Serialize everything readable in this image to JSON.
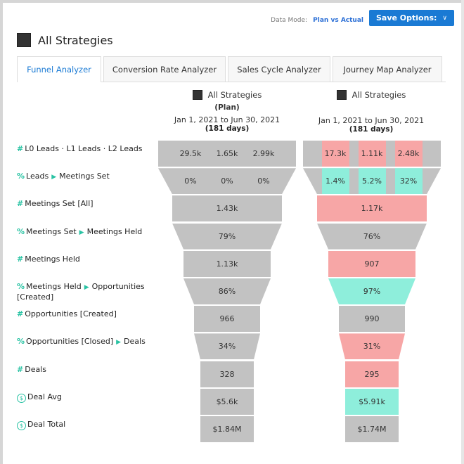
{
  "header": {
    "data_mode_label": "Data Mode:",
    "data_mode_value": "Plan vs Actual",
    "save_button_label": "Save Options:"
  },
  "title": "All Strategies",
  "tabs": [
    {
      "label": "Funnel Analyzer",
      "active": true
    },
    {
      "label": "Conversion Rate Analyzer",
      "active": false
    },
    {
      "label": "Sales Cycle Analyzer",
      "active": false
    },
    {
      "label": "Journey Map Analyzer",
      "active": false
    }
  ],
  "columns": [
    {
      "strategy": "All Strategies",
      "mode": "(Plan)",
      "dates": "Jan 1, 2021 to Jun 30, 2021",
      "days": "(181 days)"
    },
    {
      "strategy": "All Strategies",
      "mode": "",
      "dates": "Jan 1, 2021 to Jun 30, 2021",
      "days": "(181 days)"
    }
  ],
  "colors": {
    "neutral": "#c2c2c2",
    "below": "#f7a6a6",
    "above": "#8eeedb",
    "accent": "#2ac3a4"
  },
  "rows": [
    {
      "icon": "#",
      "label_parts": [
        "L0 Leads · L1 Leads · L2 Leads"
      ],
      "plan": [
        "29.5k",
        "1.65k",
        "2.99k"
      ],
      "actual": [
        "17.3k",
        "1.11k",
        "2.48k"
      ],
      "actual_status": [
        "below",
        "below",
        "below"
      ]
    },
    {
      "icon": "%",
      "label_parts": [
        "Leads",
        "Meetings Set"
      ],
      "plan": [
        "0%",
        "0%",
        "0%"
      ],
      "actual": [
        "1.4%",
        "5.2%",
        "32%"
      ],
      "actual_status": [
        "above",
        "above",
        "above"
      ]
    },
    {
      "icon": "#",
      "label_parts": [
        "Meetings Set [All]"
      ],
      "plan": [
        "1.43k"
      ],
      "actual": [
        "1.17k"
      ],
      "actual_status": [
        "below"
      ]
    },
    {
      "icon": "%",
      "label_parts": [
        "Meetings Set",
        "Meetings Held"
      ],
      "plan": [
        "79%"
      ],
      "actual": [
        "76%"
      ],
      "actual_status": [
        "neutral"
      ]
    },
    {
      "icon": "#",
      "label_parts": [
        "Meetings Held"
      ],
      "plan": [
        "1.13k"
      ],
      "actual": [
        "907"
      ],
      "actual_status": [
        "below"
      ]
    },
    {
      "icon": "%",
      "label_parts": [
        "Meetings Held",
        "Opportunities [Created]"
      ],
      "plan": [
        "86%"
      ],
      "actual": [
        "97%"
      ],
      "actual_status": [
        "above"
      ]
    },
    {
      "icon": "#",
      "label_parts": [
        "Opportunities [Created]"
      ],
      "plan": [
        "966"
      ],
      "actual": [
        "990"
      ],
      "actual_status": [
        "neutral"
      ]
    },
    {
      "icon": "%",
      "label_parts": [
        "Opportunities [Closed]",
        "Deals"
      ],
      "plan": [
        "34%"
      ],
      "actual": [
        "31%"
      ],
      "actual_status": [
        "below"
      ]
    },
    {
      "icon": "#",
      "label_parts": [
        "Deals"
      ],
      "plan": [
        "328"
      ],
      "actual": [
        "295"
      ],
      "actual_status": [
        "below"
      ]
    },
    {
      "icon": "$",
      "label_parts": [
        "Deal Avg"
      ],
      "plan": [
        "$5.6k"
      ],
      "actual": [
        "$5.91k"
      ],
      "actual_status": [
        "above"
      ]
    },
    {
      "icon": "$",
      "label_parts": [
        "Deal Total"
      ],
      "plan": [
        "$1.84M"
      ],
      "actual": [
        "$1.74M"
      ],
      "actual_status": [
        "neutral"
      ]
    }
  ]
}
